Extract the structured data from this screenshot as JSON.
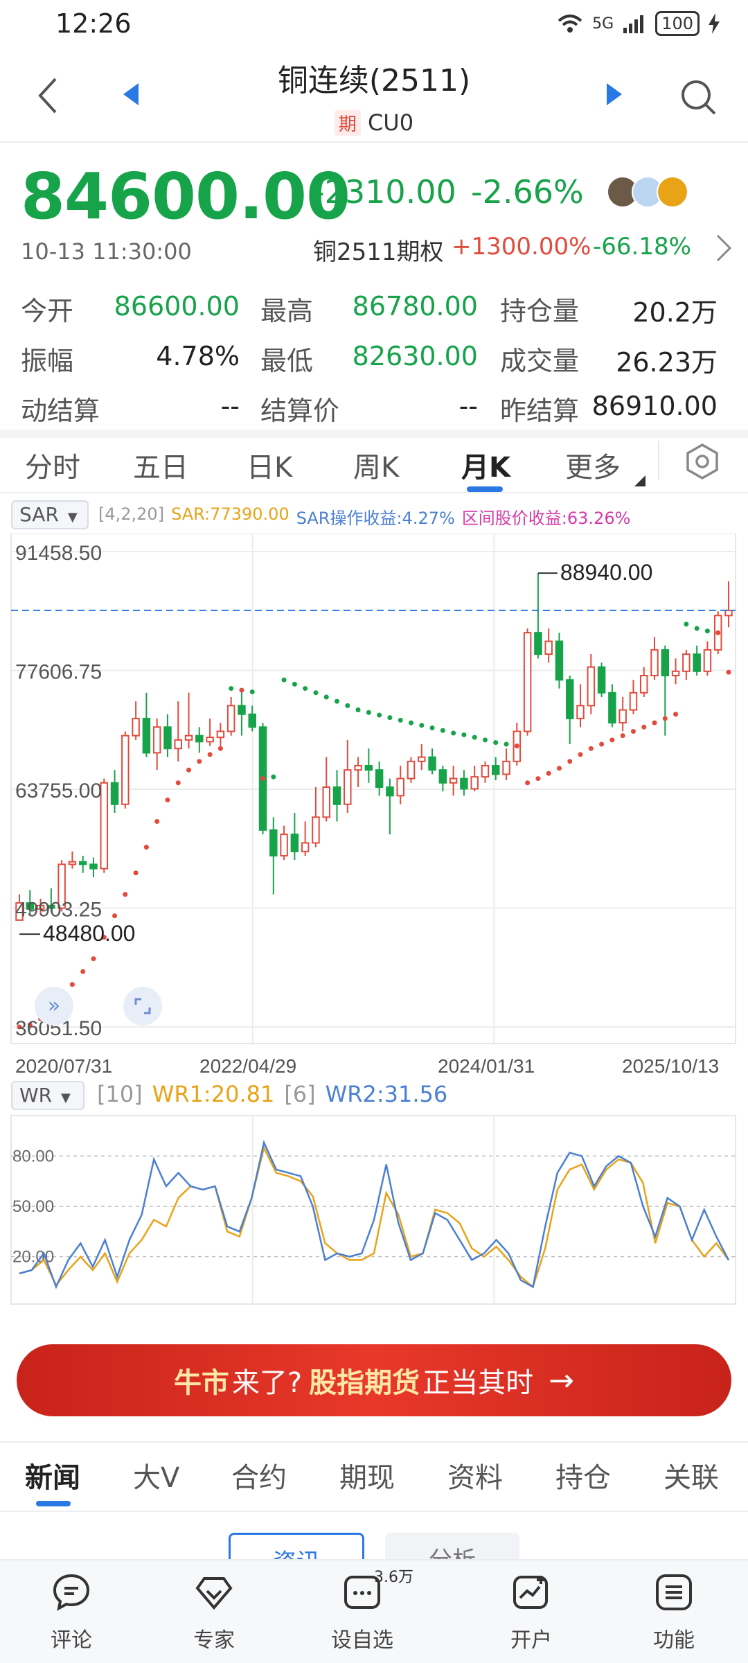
{
  "status": {
    "time": "12:26",
    "signal": "5G",
    "battery": "100"
  },
  "header": {
    "title": "铜连续(2511)",
    "badge": "期",
    "code": "CU0"
  },
  "quote": {
    "last": "84600.00",
    "change": "-2310.00",
    "change_pct": "-2.66%",
    "timestamp": "10-13 11:30:00",
    "option_name": "铜2511期权",
    "option_up": "+1300.00%",
    "option_down": "-66.18%"
  },
  "stats": [
    {
      "label": "今开",
      "value": "86600.00"
    },
    {
      "label": "最高",
      "value": "86780.00"
    },
    {
      "label": "持仓量",
      "value": "20.2万"
    },
    {
      "label": "振幅",
      "value": "4.78%"
    },
    {
      "label": "最低",
      "value": "82630.00"
    },
    {
      "label": "成交量",
      "value": "26.23万"
    },
    {
      "label": "动结算",
      "value": "--"
    },
    {
      "label": "结算价",
      "value": "--"
    },
    {
      "label": "昨结算",
      "value": "86910.00"
    }
  ],
  "period_tabs": [
    "分时",
    "五日",
    "日K",
    "周K",
    "月K",
    "更多"
  ],
  "active_period": "月K",
  "indicator": {
    "name": "SAR",
    "params": "[4,2,20]",
    "sar": "SAR:77390.00",
    "sar_return": "SAR操作收益:4.27%",
    "interval_return": "区间股价收益:63.26%"
  },
  "wr": {
    "name": "WR",
    "p1": "[10]",
    "wr1": "WR1:20.81",
    "p2": "[6]",
    "wr2": "WR2:31.56"
  },
  "banner": {
    "part1": "牛市",
    "part2": "来了?",
    "part3": "股指期货",
    "part4": "正当其时",
    "arrow": "→"
  },
  "news_tabs": [
    "新闻",
    "大V",
    "合约",
    "期现",
    "资料",
    "持仓",
    "关联"
  ],
  "news_pills": [
    "资讯",
    "分析"
  ],
  "bottom_nav": [
    {
      "label": "评论",
      "icon": "comment-icon"
    },
    {
      "label": "专家",
      "icon": "expert-icon"
    },
    {
      "label": "设自选",
      "icon": "watchlist-icon",
      "badge": "3.6万"
    },
    {
      "label": "开户",
      "icon": "open-account-icon"
    },
    {
      "label": "功能",
      "icon": "menu-icon"
    }
  ],
  "colors": {
    "up": "#e24a3b",
    "down": "#16a34a",
    "accent": "#2a78e4",
    "wr1": "#e8a317",
    "wr2": "#4a7fd4"
  },
  "chart_data": [
    {
      "type": "candlestick",
      "title": "",
      "y_tick_labels": [
        "91458.50",
        "77606.75",
        "63755.00",
        "49903.25",
        "36051.50"
      ],
      "x_tick_labels": [
        "2020/07/31",
        "2022/04/29",
        "2024/01/31",
        "2025/10/13"
      ],
      "max_marker": "88940.00",
      "min_marker": "48480.00",
      "reference_line": 84600,
      "ylim": [
        36051.5,
        91458.5
      ],
      "candles": [
        {
          "o": 48500,
          "c": 50500,
          "h": 51500,
          "l": 48480
        },
        {
          "o": 50500,
          "c": 49800,
          "h": 52000,
          "l": 49000
        },
        {
          "o": 49800,
          "c": 50200,
          "h": 51000,
          "l": 49200
        },
        {
          "o": 50200,
          "c": 49900,
          "h": 52200,
          "l": 49500
        },
        {
          "o": 49900,
          "c": 55000,
          "h": 55500,
          "l": 49500
        },
        {
          "o": 55000,
          "c": 55300,
          "h": 56500,
          "l": 54500
        },
        {
          "o": 55300,
          "c": 55000,
          "h": 56000,
          "l": 54000
        },
        {
          "o": 55000,
          "c": 54500,
          "h": 55800,
          "l": 53500
        },
        {
          "o": 54500,
          "c": 64500,
          "h": 65000,
          "l": 54000
        },
        {
          "o": 64500,
          "c": 62000,
          "h": 66000,
          "l": 61000
        },
        {
          "o": 62000,
          "c": 70000,
          "h": 70500,
          "l": 61500
        },
        {
          "o": 70000,
          "c": 72000,
          "h": 74000,
          "l": 69500
        },
        {
          "o": 72000,
          "c": 68000,
          "h": 75000,
          "l": 67500
        },
        {
          "o": 68000,
          "c": 71000,
          "h": 72000,
          "l": 66000
        },
        {
          "o": 71000,
          "c": 68500,
          "h": 72500,
          "l": 67500
        },
        {
          "o": 68500,
          "c": 69500,
          "h": 74000,
          "l": 67000
        },
        {
          "o": 69500,
          "c": 70000,
          "h": 75000,
          "l": 68500
        },
        {
          "o": 70000,
          "c": 69300,
          "h": 71000,
          "l": 68000
        },
        {
          "o": 69300,
          "c": 69800,
          "h": 72000,
          "l": 68800
        },
        {
          "o": 69800,
          "c": 70500,
          "h": 71500,
          "l": 68500
        },
        {
          "o": 70500,
          "c": 73500,
          "h": 74500,
          "l": 70000
        },
        {
          "o": 73500,
          "c": 72500,
          "h": 75500,
          "l": 70000
        },
        {
          "o": 72500,
          "c": 71000,
          "h": 73500,
          "l": 70500
        },
        {
          "o": 71000,
          "c": 59000,
          "h": 71500,
          "l": 58500
        },
        {
          "o": 59000,
          "c": 56000,
          "h": 60500,
          "l": 51500
        },
        {
          "o": 56000,
          "c": 58500,
          "h": 59500,
          "l": 55500
        },
        {
          "o": 58500,
          "c": 56500,
          "h": 61000,
          "l": 55500
        },
        {
          "o": 56500,
          "c": 57500,
          "h": 60000,
          "l": 56000
        },
        {
          "o": 57500,
          "c": 60500,
          "h": 64000,
          "l": 57000
        },
        {
          "o": 60500,
          "c": 64000,
          "h": 67500,
          "l": 60000
        },
        {
          "o": 64000,
          "c": 62000,
          "h": 66000,
          "l": 60000
        },
        {
          "o": 62000,
          "c": 66000,
          "h": 69500,
          "l": 61000
        },
        {
          "o": 66000,
          "c": 66500,
          "h": 67500,
          "l": 64000
        },
        {
          "o": 66500,
          "c": 66000,
          "h": 68500,
          "l": 64500
        },
        {
          "o": 66000,
          "c": 64000,
          "h": 67000,
          "l": 63000
        },
        {
          "o": 64000,
          "c": 63000,
          "h": 65000,
          "l": 58500
        },
        {
          "o": 63000,
          "c": 65000,
          "h": 66500,
          "l": 62000
        },
        {
          "o": 65000,
          "c": 67000,
          "h": 67500,
          "l": 64500
        },
        {
          "o": 67000,
          "c": 67500,
          "h": 69000,
          "l": 66000
        },
        {
          "o": 67500,
          "c": 66000,
          "h": 68500,
          "l": 65500
        },
        {
          "o": 66000,
          "c": 64500,
          "h": 66500,
          "l": 63500
        },
        {
          "o": 64500,
          "c": 65000,
          "h": 66500,
          "l": 63000
        },
        {
          "o": 65000,
          "c": 63800,
          "h": 66000,
          "l": 63000
        },
        {
          "o": 63800,
          "c": 65200,
          "h": 66500,
          "l": 63500
        },
        {
          "o": 65200,
          "c": 66500,
          "h": 67000,
          "l": 64500
        },
        {
          "o": 66500,
          "c": 65500,
          "h": 67500,
          "l": 64800
        },
        {
          "o": 65500,
          "c": 67000,
          "h": 68500,
          "l": 64800
        },
        {
          "o": 67000,
          "c": 70500,
          "h": 71500,
          "l": 66500
        },
        {
          "o": 70500,
          "c": 82000,
          "h": 82500,
          "l": 70000
        },
        {
          "o": 82000,
          "c": 79500,
          "h": 88940,
          "l": 79000
        },
        {
          "o": 79500,
          "c": 81000,
          "h": 82500,
          "l": 78500
        },
        {
          "o": 81000,
          "c": 76500,
          "h": 82000,
          "l": 75500
        },
        {
          "o": 76500,
          "c": 72000,
          "h": 77000,
          "l": 69000
        },
        {
          "o": 72000,
          "c": 73500,
          "h": 76000,
          "l": 71000
        },
        {
          "o": 73500,
          "c": 78000,
          "h": 79500,
          "l": 72500
        },
        {
          "o": 78000,
          "c": 75000,
          "h": 78500,
          "l": 74500
        },
        {
          "o": 75000,
          "c": 71500,
          "h": 76000,
          "l": 71000
        },
        {
          "o": 71500,
          "c": 73000,
          "h": 74500,
          "l": 70500
        },
        {
          "o": 73000,
          "c": 75000,
          "h": 76500,
          "l": 72500
        },
        {
          "o": 75000,
          "c": 77000,
          "h": 78000,
          "l": 74500
        },
        {
          "o": 77000,
          "c": 80000,
          "h": 81500,
          "l": 76500
        },
        {
          "o": 80000,
          "c": 77000,
          "h": 80500,
          "l": 70000
        },
        {
          "o": 77000,
          "c": 77500,
          "h": 79000,
          "l": 76000
        },
        {
          "o": 77500,
          "c": 79500,
          "h": 80000,
          "l": 76500
        },
        {
          "o": 79500,
          "c": 77500,
          "h": 80500,
          "l": 77000
        },
        {
          "o": 77500,
          "c": 80000,
          "h": 81000,
          "l": 77000
        },
        {
          "o": 80000,
          "c": 84000,
          "h": 84500,
          "l": 79500
        },
        {
          "o": 84000,
          "c": 84600,
          "h": 88000,
          "l": 82630
        }
      ],
      "sar_points": [
        {
          "i": 0,
          "v": 36051.5
        },
        {
          "i": 1,
          "v": 36300
        },
        {
          "i": 2,
          "v": 37000
        },
        {
          "i": 3,
          "v": 38000
        },
        {
          "i": 4,
          "v": 39500
        },
        {
          "i": 5,
          "v": 41000
        },
        {
          "i": 6,
          "v": 42500
        },
        {
          "i": 7,
          "v": 44000
        },
        {
          "i": 8,
          "v": 46500
        },
        {
          "i": 9,
          "v": 49000
        },
        {
          "i": 10,
          "v": 51500
        },
        {
          "i": 11,
          "v": 54000
        },
        {
          "i": 12,
          "v": 57000
        },
        {
          "i": 13,
          "v": 60000
        },
        {
          "i": 14,
          "v": 62500
        },
        {
          "i": 15,
          "v": 64500
        },
        {
          "i": 16,
          "v": 66000
        },
        {
          "i": 17,
          "v": 67000
        },
        {
          "i": 18,
          "v": 67800
        },
        {
          "i": 19,
          "v": 68500
        },
        {
          "i": 20,
          "v": 75500
        },
        {
          "i": 21,
          "v": 75300
        },
        {
          "i": 22,
          "v": 75100
        },
        {
          "i": 23,
          "v": 65000
        },
        {
          "i": 24,
          "v": 65200
        },
        {
          "i": 25,
          "v": 76500
        },
        {
          "i": 26,
          "v": 76000
        },
        {
          "i": 27,
          "v": 75500
        },
        {
          "i": 28,
          "v": 75000
        },
        {
          "i": 29,
          "v": 74500
        },
        {
          "i": 30,
          "v": 74000
        },
        {
          "i": 31,
          "v": 73500
        },
        {
          "i": 32,
          "v": 73000
        },
        {
          "i": 33,
          "v": 72700
        },
        {
          "i": 34,
          "v": 72400
        },
        {
          "i": 35,
          "v": 72100
        },
        {
          "i": 36,
          "v": 71800
        },
        {
          "i": 37,
          "v": 71500
        },
        {
          "i": 38,
          "v": 71200
        },
        {
          "i": 39,
          "v": 70900
        },
        {
          "i": 40,
          "v": 70600
        },
        {
          "i": 41,
          "v": 70300
        },
        {
          "i": 42,
          "v": 70100
        },
        {
          "i": 43,
          "v": 69800
        },
        {
          "i": 44,
          "v": 69500
        },
        {
          "i": 45,
          "v": 69200
        },
        {
          "i": 46,
          "v": 69000
        },
        {
          "i": 47,
          "v": 68800
        },
        {
          "i": 48,
          "v": 64500
        },
        {
          "i": 49,
          "v": 65000
        },
        {
          "i": 50,
          "v": 65600
        },
        {
          "i": 51,
          "v": 66200
        },
        {
          "i": 52,
          "v": 67000
        },
        {
          "i": 53,
          "v": 67800
        },
        {
          "i": 54,
          "v": 68500
        },
        {
          "i": 55,
          "v": 69000
        },
        {
          "i": 56,
          "v": 69500
        },
        {
          "i": 57,
          "v": 70000
        },
        {
          "i": 58,
          "v": 70500
        },
        {
          "i": 59,
          "v": 71000
        },
        {
          "i": 60,
          "v": 71500
        },
        {
          "i": 61,
          "v": 72000
        },
        {
          "i": 62,
          "v": 72500
        },
        {
          "i": 63,
          "v": 83000
        },
        {
          "i": 64,
          "v": 82500
        },
        {
          "i": 65,
          "v": 82200
        },
        {
          "i": 66,
          "v": 82000
        },
        {
          "i": 67,
          "v": 77390
        }
      ]
    },
    {
      "type": "line",
      "title": "",
      "y_tick_labels": [
        "80.00",
        "50.00",
        "20.00"
      ],
      "ylim": [
        0,
        100
      ],
      "series": [
        {
          "name": "WR1",
          "values": [
            10,
            12,
            18,
            3,
            12,
            20,
            12,
            22,
            5,
            22,
            30,
            42,
            38,
            55,
            62,
            60,
            62,
            35,
            32,
            55,
            85,
            70,
            68,
            65,
            56,
            28,
            22,
            18,
            18,
            22,
            58,
            45,
            20,
            22,
            48,
            46,
            40,
            25,
            20,
            26,
            18,
            8,
            2,
            25,
            60,
            72,
            75,
            60,
            72,
            78,
            76,
            64,
            28,
            52,
            50,
            30,
            20,
            28,
            18
          ]
        },
        {
          "name": "WR2",
          "values": [
            10,
            12,
            22,
            2,
            18,
            28,
            14,
            30,
            8,
            30,
            45,
            78,
            62,
            70,
            62,
            60,
            62,
            38,
            35,
            55,
            88,
            72,
            70,
            68,
            50,
            18,
            22,
            20,
            22,
            42,
            75,
            40,
            18,
            22,
            46,
            42,
            30,
            18,
            22,
            30,
            22,
            6,
            2,
            38,
            70,
            82,
            80,
            62,
            74,
            80,
            76,
            50,
            32,
            55,
            50,
            30,
            48,
            32,
            18
          ]
        }
      ]
    }
  ]
}
